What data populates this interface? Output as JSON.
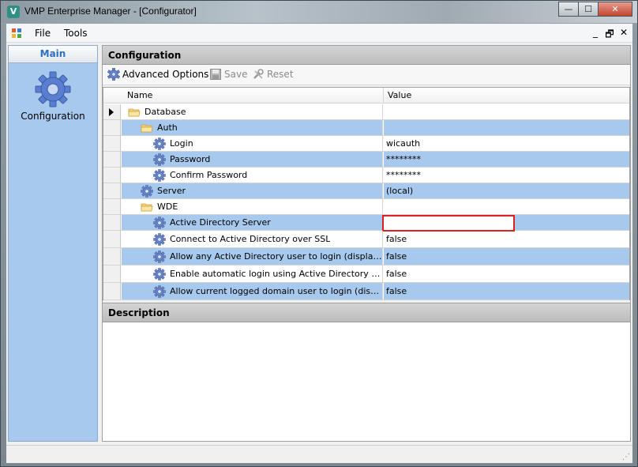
{
  "window": {
    "app_icon_letter": "V",
    "title": "VMP Enterprise Manager - [Configurator]",
    "minimize": "—",
    "maximize": "☐",
    "close": "✕"
  },
  "menubar": {
    "items": [
      "File",
      "Tools"
    ],
    "mdi_minimize": "_",
    "mdi_restore": "🗗",
    "mdi_close": "✕"
  },
  "left_pane": {
    "header": "Main",
    "item_label": "Configuration"
  },
  "configuration": {
    "header": "Configuration",
    "toolbar": {
      "advanced_options": "Advanced Options",
      "save": "Save",
      "reset": "Reset"
    },
    "columns": {
      "name": "Name",
      "value": "Value"
    },
    "rows": [
      {
        "name": "Database",
        "value": "",
        "icon": "folder-icon",
        "indent": 0,
        "highlight": false,
        "current": true
      },
      {
        "name": "Auth",
        "value": "",
        "icon": "folder-icon",
        "indent": 1,
        "highlight": true
      },
      {
        "name": "Login",
        "value": "wicauth",
        "icon": "gear-icon",
        "indent": 2,
        "highlight": false
      },
      {
        "name": "Password",
        "value": "********",
        "icon": "gear-icon",
        "indent": 2,
        "highlight": true
      },
      {
        "name": "Confirm Password",
        "value": "********",
        "icon": "gear-icon",
        "indent": 2,
        "highlight": false
      },
      {
        "name": "Server",
        "value": "(local)",
        "icon": "gear-icon",
        "indent": 1,
        "highlight": true
      },
      {
        "name": "WDE",
        "value": "",
        "icon": "folder-icon",
        "indent": 1,
        "highlight": false
      },
      {
        "name": "Active Directory Server",
        "value": "",
        "icon": "gear-icon",
        "indent": 2,
        "highlight": true,
        "editing": true
      },
      {
        "name": "Connect to Active Directory over SSL",
        "value": "false",
        "icon": "gear-icon",
        "indent": 2,
        "highlight": false
      },
      {
        "name": "Allow any Active Directory user to login (display lo...",
        "value": "false",
        "icon": "gear-icon",
        "indent": 2,
        "highlight": true
      },
      {
        "name": "Enable automatic login using Active Directory auth...",
        "value": "false",
        "icon": "gear-icon",
        "indent": 2,
        "highlight": false
      },
      {
        "name": "Allow current logged domain user to login (display...",
        "value": "false",
        "icon": "gear-icon",
        "indent": 2,
        "highlight": true
      }
    ]
  },
  "description": {
    "header": "Description"
  },
  "colors": {
    "selection_blue": "#a8c9ee",
    "edit_border": "#e02020",
    "left_header_text": "#2d6fc4"
  }
}
